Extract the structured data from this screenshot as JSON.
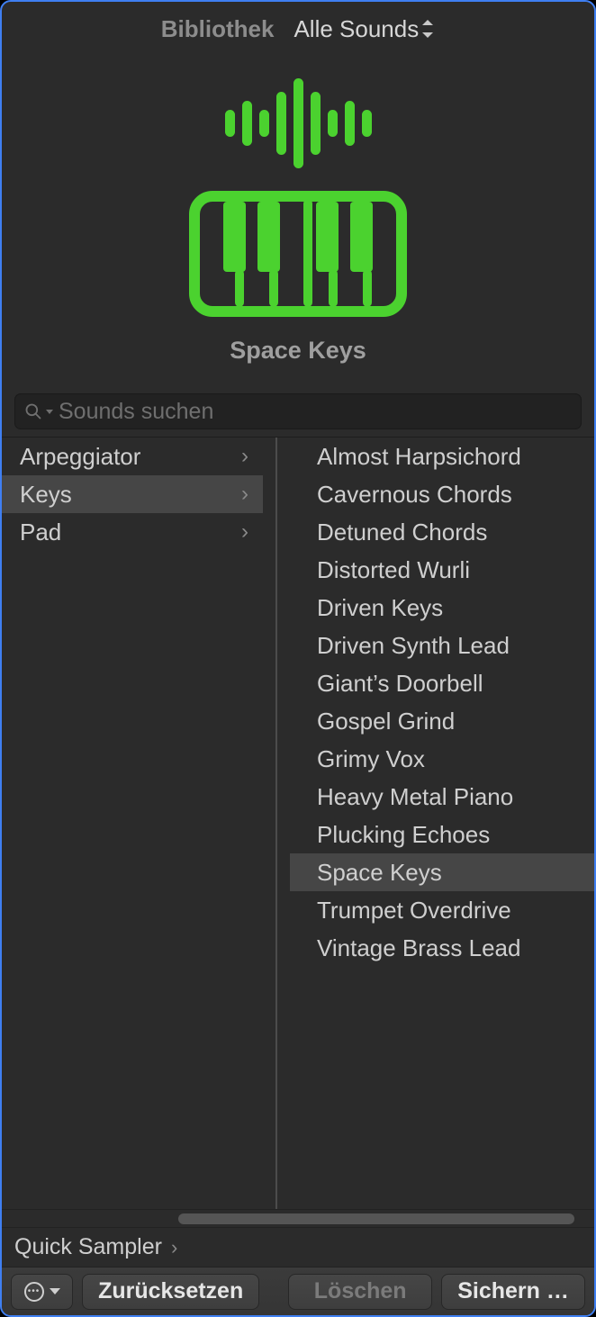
{
  "header": {
    "library_label": "Bibliothek",
    "filter_label": "Alle Sounds"
  },
  "hero": {
    "title": "Space Keys"
  },
  "search": {
    "placeholder": "Sounds suchen"
  },
  "categories": [
    {
      "label": "Arpeggiator",
      "selected": false,
      "has_children": true
    },
    {
      "label": "Keys",
      "selected": true,
      "has_children": true
    },
    {
      "label": "Pad",
      "selected": false,
      "has_children": true
    }
  ],
  "sounds": [
    {
      "label": "Almost Harpsichord",
      "selected": false
    },
    {
      "label": "Cavernous Chords",
      "selected": false
    },
    {
      "label": "Detuned Chords",
      "selected": false
    },
    {
      "label": "Distorted Wurli",
      "selected": false
    },
    {
      "label": "Driven Keys",
      "selected": false
    },
    {
      "label": "Driven Synth Lead",
      "selected": false
    },
    {
      "label": "Giant’s Doorbell",
      "selected": false
    },
    {
      "label": "Gospel Grind",
      "selected": false
    },
    {
      "label": "Grimy Vox",
      "selected": false
    },
    {
      "label": "Heavy Metal Piano",
      "selected": false
    },
    {
      "label": "Plucking Echoes",
      "selected": false
    },
    {
      "label": "Space Keys",
      "selected": true
    },
    {
      "label": "Trumpet Overdrive",
      "selected": false
    },
    {
      "label": "Vintage Brass Lead",
      "selected": false
    }
  ],
  "breadcrumb": {
    "path": "Quick Sampler"
  },
  "footer": {
    "reset": "Zurücksetzen",
    "delete": "Löschen",
    "save": "Sichern …"
  },
  "colors": {
    "accent": "#4bd22f"
  },
  "waveform_heights": [
    30,
    50,
    30,
    70,
    100,
    70,
    30,
    50,
    30
  ]
}
